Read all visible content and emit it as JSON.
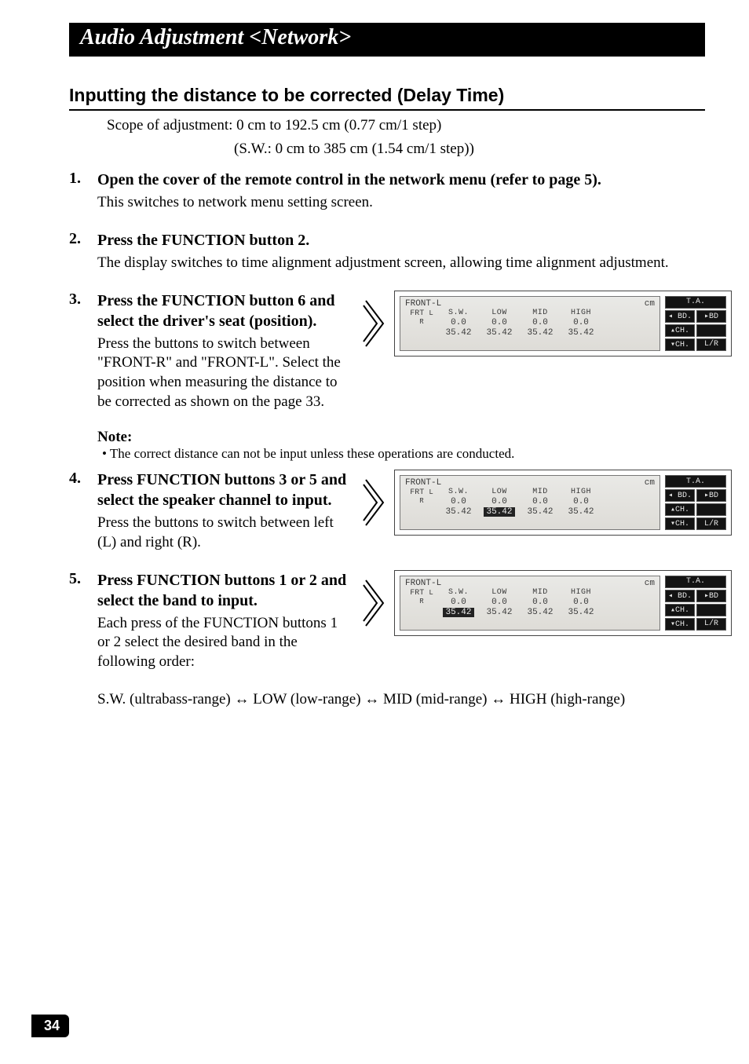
{
  "page": {
    "title": "Audio Adjustment <Network>",
    "number": "34"
  },
  "section": {
    "heading": "Inputting the distance to be corrected (Delay Time)",
    "scope_line1": "Scope of adjustment: 0 cm to 192.5 cm (0.77 cm/1 step)",
    "scope_line2": "(S.W.: 0 cm to 385 cm (1.54 cm/1 step))"
  },
  "steps": {
    "s1": {
      "num": "1.",
      "title": "Open the cover of the remote control in the network menu (refer to page 5).",
      "desc": "This switches to network menu setting screen."
    },
    "s2": {
      "num": "2.",
      "title": "Press the FUNCTION button 2.",
      "desc": "The display switches to time alignment adjustment screen, allowing time alignment adjustment."
    },
    "s3": {
      "num": "3.",
      "title": "Press the FUNCTION button 6 and select the driver's seat (position).",
      "desc": "Press the buttons to switch between \"FRONT-R\" and \"FRONT-L\". Select the position when measuring the distance to be corrected as shown on the page 33."
    },
    "s4": {
      "num": "4.",
      "title": "Press FUNCTION buttons 3 or 5 and select the speaker channel to input.",
      "desc": "Press the buttons to switch between left (L) and right (R)."
    },
    "s5": {
      "num": "5.",
      "title": "Press FUNCTION buttons 1 or 2 and select the band to input.",
      "desc": "Each press of the FUNCTION buttons 1 or 2 select the desired band in the following order:"
    }
  },
  "note": {
    "label": "Note:",
    "text": "• The correct distance can not be input unless these operations are conducted."
  },
  "band_order": "S.W. (ultrabass-range) ↔ LOW (low-range) ↔ MID (mid-range) ↔ HIGH (high-range)",
  "lcd": {
    "title": "FRONT-L",
    "unit": "cm",
    "cols": [
      "S.W.",
      "LOW",
      "MID",
      "HIGH"
    ],
    "frt": "FRT",
    "frtL": "L",
    "frtR": "R",
    "rowL": [
      "0.0",
      "0.0",
      "0.0",
      "0.0"
    ],
    "rowR": [
      "35.42",
      "35.42",
      "35.42",
      "35.42"
    ],
    "side": {
      "ta": "T.A.",
      "bd_left": "◂ BD.",
      "bd_right": "▸BD",
      "ch_up": "▴CH.",
      "ch_down": "▾CH.",
      "lr": "L/R"
    }
  }
}
